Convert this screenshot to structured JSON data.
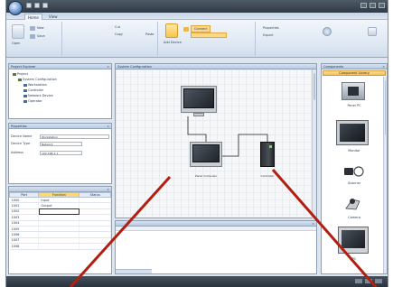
{
  "app": {
    "tabs": [
      {
        "label": "Home"
      },
      {
        "label": "View"
      }
    ]
  },
  "ribbon": {
    "groups": [
      {
        "items": [
          "Open",
          "New",
          "Save"
        ]
      },
      {
        "items": [
          "Cut",
          "Copy",
          "Paste"
        ]
      },
      {
        "items": [
          "Add Device",
          "Connect"
        ]
      },
      {
        "items": [
          "Properties",
          "Export"
        ]
      }
    ]
  },
  "explorer": {
    "title": "Project Explorer",
    "items": [
      "Project",
      "System Configuration",
      "Workstation",
      "Controller",
      "Network Device",
      "Operator"
    ]
  },
  "properties": {
    "title": "Properties",
    "rows": [
      {
        "label": "Device Name",
        "value": "Workstation"
      },
      {
        "label": "Device Type",
        "value": "Network"
      },
      {
        "label": "Address",
        "value": "192.168.1.1"
      }
    ]
  },
  "table": {
    "columns": [
      "Port",
      "Function",
      "Status"
    ],
    "rows": [
      [
        "1000",
        "Input",
        ""
      ],
      [
        "1001",
        "Output",
        ""
      ],
      [
        "1002",
        "",
        ""
      ],
      [
        "1003",
        "",
        ""
      ],
      [
        "1004",
        "",
        ""
      ],
      [
        "1005",
        "",
        ""
      ],
      [
        "1006",
        "",
        ""
      ],
      [
        "1007",
        "",
        ""
      ],
      [
        "1008",
        "",
        ""
      ]
    ]
  },
  "canvas": {
    "title": "System Configuration",
    "devices": [
      {
        "label": ""
      },
      {
        "label": "Panel Computer"
      },
      {
        "label": "Controller"
      }
    ]
  },
  "output": {
    "title": ""
  },
  "toolbox": {
    "title": "Components",
    "header": "Component Library",
    "items": [
      {
        "label": "Panel PC"
      },
      {
        "label": "Monitor"
      },
      {
        "label": "Scanner"
      },
      {
        "label": "Camera"
      },
      {
        "label": "PC"
      }
    ]
  },
  "colors": {
    "annotation_line": "#b21e10",
    "ribbon_highlight": "#f7c451",
    "titlebar": "#2f3a45"
  }
}
